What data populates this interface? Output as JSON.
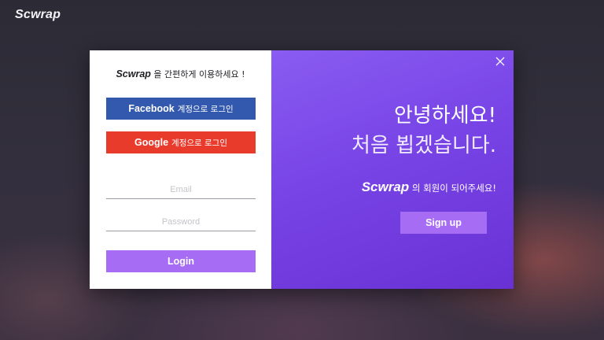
{
  "app": {
    "logo": "Scwrap"
  },
  "login_panel": {
    "tagline_brand": "Scwrap",
    "tagline_text": " 을 간편하게 이용하세요 !",
    "facebook_button": {
      "brand": "Facebook",
      "text": "계정으로 로그인"
    },
    "google_button": {
      "brand": "Google",
      "text": "계정으로 로그인"
    },
    "email_placeholder": "Email",
    "password_placeholder": "Password",
    "login_label": "Login"
  },
  "signup_panel": {
    "greeting_line1": "안녕하세요!",
    "greeting_line2": "처음 뵙겠습니다.",
    "invite_brand": "Scwrap",
    "invite_text": " 의 회원이 되어주세요!",
    "signup_label": "Sign up"
  },
  "colors": {
    "facebook": "#3359ae",
    "google": "#e93b2c",
    "accent_button": "#a66cf3",
    "panel_gradient_start": "#8a5cf2",
    "panel_gradient_end": "#6931d4"
  },
  "icons": {
    "close": "close-icon"
  }
}
